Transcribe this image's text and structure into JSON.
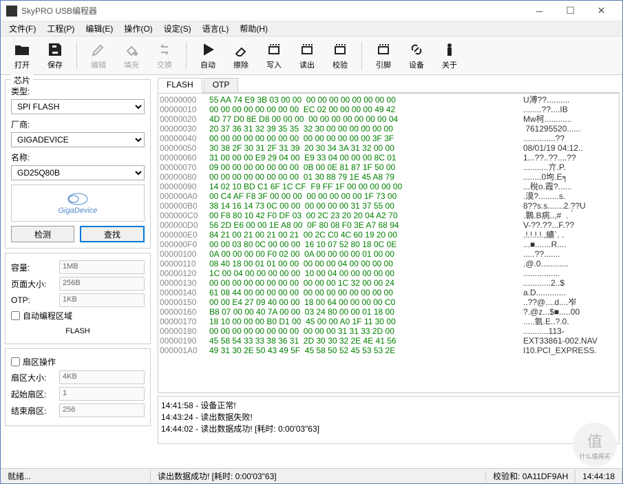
{
  "window": {
    "title": "SkyPRO USB编程器"
  },
  "menu": [
    "文件(F)",
    "工程(P)",
    "编辑(E)",
    "操作(O)",
    "设定(S)",
    "语言(L)",
    "帮助(H)"
  ],
  "toolbar": [
    {
      "name": "open",
      "label": "打开",
      "icon": "folder"
    },
    {
      "name": "save",
      "label": "保存",
      "icon": "save"
    },
    {
      "sep": true
    },
    {
      "name": "edit",
      "label": "编辑",
      "icon": "edit",
      "disabled": true
    },
    {
      "name": "fill",
      "label": "填充",
      "icon": "fill",
      "disabled": true
    },
    {
      "name": "swap",
      "label": "交换",
      "icon": "swap",
      "disabled": true
    },
    {
      "sep": true
    },
    {
      "name": "auto",
      "label": "自动",
      "icon": "play"
    },
    {
      "name": "erase",
      "label": "擦除",
      "icon": "erase"
    },
    {
      "name": "write",
      "label": "写入",
      "icon": "chip-w"
    },
    {
      "name": "read",
      "label": "读出",
      "icon": "chip-r"
    },
    {
      "name": "verify",
      "label": "校验",
      "icon": "chip-v"
    },
    {
      "sep": true
    },
    {
      "name": "pin",
      "label": "引脚",
      "icon": "chip-p"
    },
    {
      "name": "device",
      "label": "设备",
      "icon": "link"
    },
    {
      "name": "about",
      "label": "关于",
      "icon": "info"
    }
  ],
  "chip": {
    "group_title": "芯片",
    "type_label": "类型:",
    "type_value": "SPI FLASH",
    "vendor_label": "厂商:",
    "vendor_value": "GIGADEVICE",
    "name_label": "名称:",
    "name_value": "GD25Q80B",
    "logo_text": "GigaDevice",
    "detect_btn": "检测",
    "find_btn": "查找"
  },
  "info": {
    "capacity_label": "容量:",
    "capacity_value": "1MB",
    "pagesize_label": "页面大小:",
    "pagesize_value": "256B",
    "otp_label": "OTP:",
    "otp_value": "1KB",
    "autoprog_chk": "自动编程区域",
    "flash_label": "FLASH"
  },
  "sector": {
    "chk_label": "扇区操作",
    "size_label": "扇区大小:",
    "size_value": "4KB",
    "start_label": "起始扇区:",
    "start_value": "1",
    "end_label": "结束扇区:",
    "end_value": "256"
  },
  "tabs": [
    "FLASH",
    "OTP"
  ],
  "hex": [
    {
      "a": "00000000",
      "b": "55 AA 74 E9 3B 03 00 00  00 00 00 00 00 00 00 00",
      "t": "U溥??.........."
    },
    {
      "a": "00000010",
      "b": "00 00 00 00 00 00 00 00  EC 02 00 00 00 00 49 42",
      "t": "........??....IB"
    },
    {
      "a": "00000020",
      "b": "4D 77 D0 8E D8 00 00 00  00 00 00 00 00 00 00 04",
      "t": "Mw柯............"
    },
    {
      "a": "00000030",
      "b": "20 37 36 31 32 39 35 35  32 30 00 00 00 00 00 00",
      "t": " 761295520......"
    },
    {
      "a": "00000040",
      "b": "00 00 00 00 00 00 00 00  00 00 00 00 00 00 3F 3F",
      "t": "..............??"
    },
    {
      "a": "00000050",
      "b": "30 38 2F 30 31 2F 31 39  20 30 34 3A 31 32 00 00",
      "t": "08/01/19 04:12.."
    },
    {
      "a": "00000060",
      "b": "31 00 00 00 E9 29 04 00  E9 33 04 00 00 00 8C 01",
      "t": "1...??..??....??"
    },
    {
      "a": "00000070",
      "b": "09 00 00 00 00 00 00 00  0B 00 0E 81 87 1F 50 00",
      "t": "...........亣.P."
    },
    {
      "a": "00000080",
      "b": "00 00 00 00 00 00 00 00  01 30 88 79 1E 45 A8 79",
      "t": "........0坸.E╕"
    },
    {
      "a": "00000090",
      "b": "14 02 10 BD C1 6F 1C CF  F9 FF 1F 00 00 00 00 00",
      "t": "...稅o.霞?......"
    },
    {
      "a": "000000A0",
      "b": "00 C4 AF F8 3F 00 00 00  00 00 00 00 00 1F 73 00",
      "t": ".漠?.........s."
    },
    {
      "a": "000000B0",
      "b": "38 14 16 14 73 0C 00 00  00 00 00 00 31 37 55 00",
      "t": "8??s.s.......2.??U"
    },
    {
      "a": "000000C0",
      "b": "00 F8 80 10 42 F0 DF 03  00 2C 23 20 20 04 A2 70",
      "t": ".鷣.B病..,#  .｀"
    },
    {
      "a": "000000D0",
      "b": "56 2D E6 00 00 1E A8 00  0F 80 08 F0 3E A7 68 94",
      "t": "V-??.??...F.??"
    },
    {
      "a": "000000E0",
      "b": "84 21 00 21 00 21 00 21  00 2C C0 4C 60 19 20 00",
      "t": ".!.!.!.!.,纊`. ."
    },
    {
      "a": "000000F0",
      "b": "00 00 03 80 0C 00 00 00  16 10 07 52 80 18 0C 0E",
      "t": "...■.......R...."
    },
    {
      "a": "00000100",
      "b": "0A 00 00 00 00 F0 02 00  0A 00 00 00 00 01 00 00",
      "t": ".....??......."
    },
    {
      "a": "00000110",
      "b": "08 40 18 00 01 01 00 00  00 00 00 04 00 00 00 00",
      "t": ".@.0............"
    },
    {
      "a": "00000120",
      "b": "1C 00 04 00 00 00 00 00  10 00 04 00 00 00 00 00",
      "t": "................"
    },
    {
      "a": "00000130",
      "b": "00 00 00 00 00 00 00 00  00 00 00 1C 32 00 00 24",
      "t": "............2..$"
    },
    {
      "a": "00000140",
      "b": "61 08 44 00 00 00 00 00  00 00 00 00 00 00 00 00",
      "t": "a.D............."
    },
    {
      "a": "00000150",
      "b": "00 00 E4 27 09 40 00 00  18 00 64 00 00 00 00 C0",
      "t": "..??@....d....岝"
    },
    {
      "a": "00000160",
      "b": "B8 07 00 00 40 7A 00 00  03 24 80 00 00 01 18 00",
      "t": "?.@z...$■.....00"
    },
    {
      "a": "00000170",
      "b": "18 10 00 00 00 B0 D1 00  45 00 00 A0 1F 11 30 00",
      "t": ".....氨.E..?.0."
    },
    {
      "a": "00000180",
      "b": "00 00 00 00 00 00 00 00  00 00 00 31 31 33 2D 00",
      "t": "...........113-"
    },
    {
      "a": "00000190",
      "b": "45 58 54 33 33 38 36 31  2D 30 30 32 2E 4E 41 56",
      "t": "EXT33861-002.NAV"
    },
    {
      "a": "000001A0",
      "b": "49 31 30 2E 50 43 49 5F  45 58 50 52 45 53 53 2E",
      "t": "I10.PCI_EXPRESS."
    }
  ],
  "log": [
    "14:41:58 - 设备正常!",
    "14:43:24 - 读出数据失败!",
    "14:44:02 - 读出数据成功! [耗时: 0:00'03\"63]"
  ],
  "status": {
    "left": "就绪...",
    "mid": "读出数据成功! [耗时: 0:00'03\"63]",
    "checksum": "校验和: 0A11DF9AH",
    "time": "14:44:18"
  },
  "watermark": {
    "top": "值",
    "bottom": "什么值得买"
  }
}
